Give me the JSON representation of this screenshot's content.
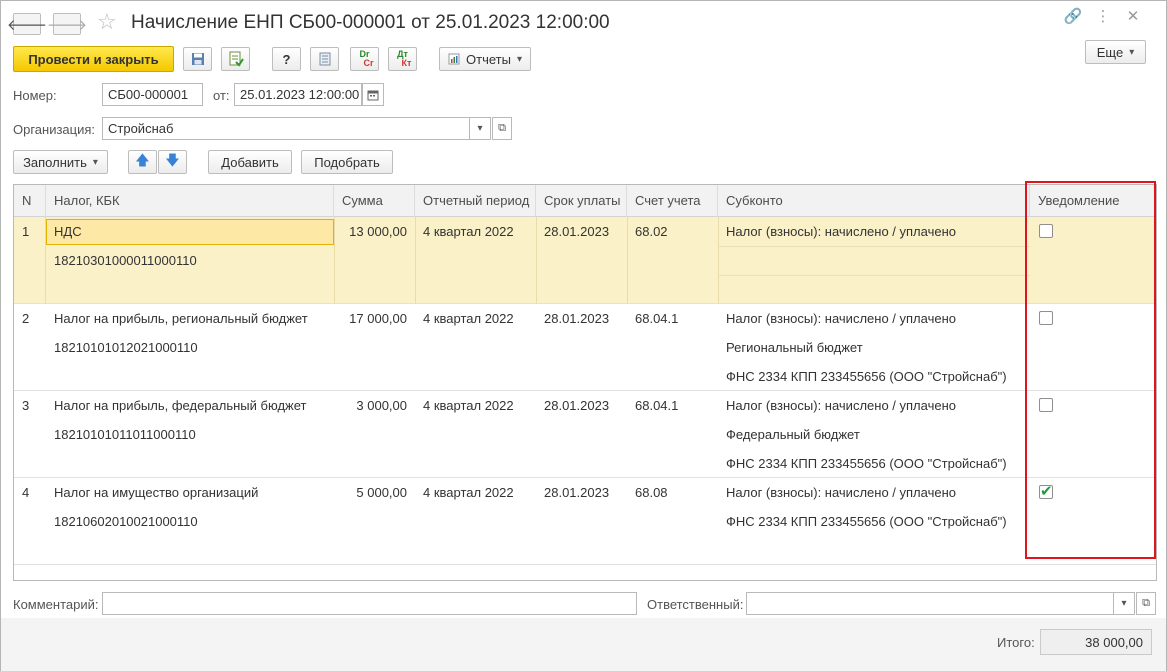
{
  "window": {
    "title": "Начисление ЕНП СБ00-000001 от 25.01.2023 12:00:00"
  },
  "toolbar": {
    "post_close": "Провести и закрыть",
    "help": "?",
    "dr_top": "Dr",
    "dr_bottom": "Cr",
    "dt_top": "Дт",
    "dt_bottom": "Кт",
    "reports": "Отчеты",
    "more": "Еще"
  },
  "form": {
    "number_label": "Номер:",
    "number_value": "СБ00-000001",
    "date_label": "от:",
    "date_value": "25.01.2023 12:00:00",
    "org_label": "Организация:",
    "org_value": "Стройснаб"
  },
  "table_toolbar": {
    "fill": "Заполнить",
    "add": "Добавить",
    "pick": "Подобрать"
  },
  "table": {
    "columns": [
      "N",
      "Налог, КБК",
      "Сумма",
      "Отчетный период",
      "Срок уплаты",
      "Счет учета",
      "Субконто",
      "Уведомление"
    ],
    "rows": [
      {
        "n": "1",
        "tax": "НДС",
        "kbk": "18210301000011000110",
        "sum": "13 000,00",
        "period": "4 квартал 2022",
        "due": "28.01.2023",
        "account": "68.02",
        "subconto": [
          "Налог (взносы): начислено / уплачено",
          "",
          ""
        ],
        "notice": false
      },
      {
        "n": "2",
        "tax": "Налог на прибыль, региональный бюджет",
        "kbk": "18210101012021000110",
        "sum": "17 000,00",
        "period": "4 квартал 2022",
        "due": "28.01.2023",
        "account": "68.04.1",
        "subconto": [
          "Налог (взносы): начислено / уплачено",
          "Региональный бюджет",
          "ФНС 2334 КПП 233455656 (ООО \"Стройснаб\")"
        ],
        "notice": false
      },
      {
        "n": "3",
        "tax": "Налог на прибыль, федеральный бюджет",
        "kbk": "18210101011011000110",
        "sum": "3 000,00",
        "period": "4 квартал 2022",
        "due": "28.01.2023",
        "account": "68.04.1",
        "subconto": [
          "Налог (взносы): начислено / уплачено",
          "Федеральный бюджет",
          "ФНС 2334 КПП 233455656 (ООО \"Стройснаб\")"
        ],
        "notice": false
      },
      {
        "n": "4",
        "tax": "Налог на имущество организаций",
        "kbk": "18210602010021000110",
        "sum": "5 000,00",
        "period": "4 квартал 2022",
        "due": "28.01.2023",
        "account": "68.08",
        "subconto": [
          "Налог (взносы): начислено / уплачено",
          "ФНС 2334 КПП 233455656 (ООО \"Стройснаб\")",
          ""
        ],
        "notice": true
      }
    ]
  },
  "footer": {
    "comment_label": "Комментарий:",
    "comment_value": "",
    "responsible_label": "Ответственный:",
    "responsible_value": "",
    "total_label": "Итого:",
    "total_value": "38 000,00"
  },
  "colors": {
    "primary_button": "#f5c800",
    "selected_row": "#fbf1c8",
    "highlight_frame": "#e0141e",
    "checkbox_check": "#1f9d3d"
  }
}
